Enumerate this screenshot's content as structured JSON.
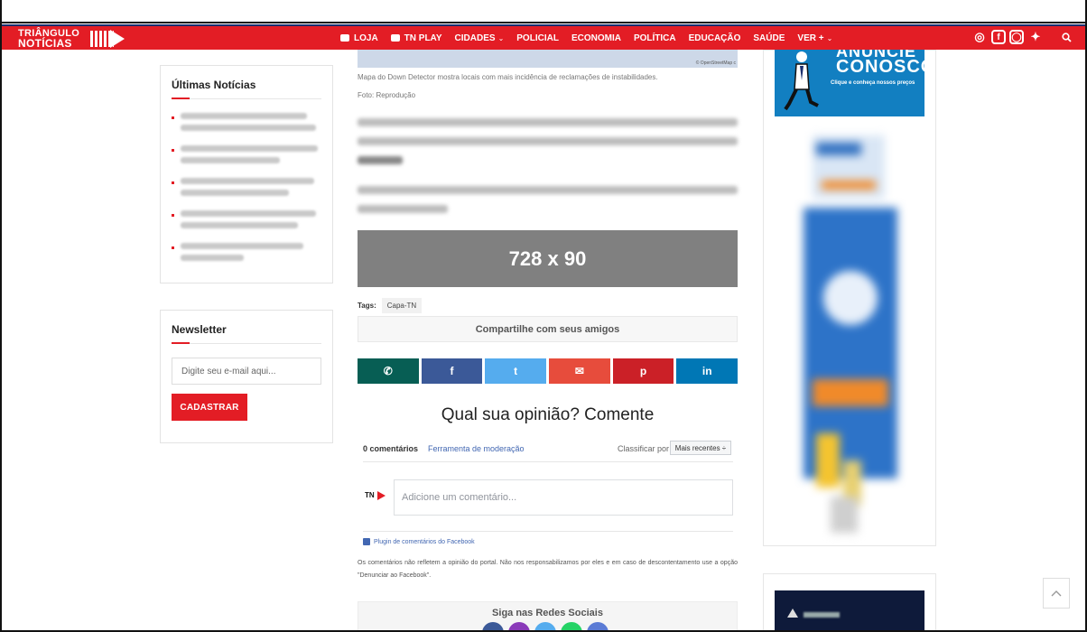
{
  "header": {
    "logo_line1": "TRIÂNGULO",
    "logo_line2": "NOTÍCIAS",
    "menu": [
      {
        "label": "LOJA",
        "icon": "store-icon",
        "chevron": false
      },
      {
        "label": "TN PLAY",
        "icon": "video-camera-icon",
        "chevron": false
      },
      {
        "label": "CIDADES",
        "icon": "",
        "chevron": true
      },
      {
        "label": "POLICIAL",
        "icon": "",
        "chevron": false
      },
      {
        "label": "ECONOMIA",
        "icon": "",
        "chevron": false
      },
      {
        "label": "POLÍTICA",
        "icon": "",
        "chevron": false
      },
      {
        "label": "EDUCAÇÃO",
        "icon": "",
        "chevron": false
      },
      {
        "label": "SAÚDE",
        "icon": "",
        "chevron": false
      },
      {
        "label": "VER +",
        "icon": "",
        "chevron": true
      }
    ],
    "social_icons": [
      "whatsapp-icon",
      "facebook-icon",
      "instagram-icon",
      "twitter-icon"
    ],
    "search_icon": "search-icon",
    "brand_red": "#e31d25"
  },
  "left_sidebar": {
    "latest_title": "Últimas Notícias",
    "newsletter_title": "Newsletter",
    "newsletter_placeholder": "Digite seu e-mail aqui...",
    "newsletter_button": "CADASTRAR"
  },
  "article": {
    "map_credit": "© OpenStreetMap c",
    "caption": "Mapa do Down Detector mostra locais com mais incidência de reclamações de instabilidades.",
    "photo_credit": "Foto: Reprodução",
    "ad_label": "728 x 90",
    "tags_label": "Tags:",
    "tags": [
      "Capa-TN"
    ],
    "share_title": "Compartilhe com seus amigos",
    "share_buttons": [
      {
        "icon": "whatsapp-icon",
        "glyph": "✆",
        "color": "#075e54"
      },
      {
        "icon": "facebook-icon",
        "glyph": "f",
        "color": "#3b5998"
      },
      {
        "icon": "twitter-icon",
        "glyph": "t",
        "color": "#55acee"
      },
      {
        "icon": "email-icon",
        "glyph": "✉",
        "color": "#e74c3c"
      },
      {
        "icon": "pinterest-icon",
        "glyph": "p",
        "color": "#cb2027"
      },
      {
        "icon": "linkedin-icon",
        "glyph": "in",
        "color": "#0077b5"
      }
    ]
  },
  "comments": {
    "heading": "Qual sua opinião? Comente",
    "count_label": "0 comentários",
    "moderation_link": "Ferramenta de moderação",
    "sort_label": "Classificar por",
    "sort_value": "Mais recentes ÷",
    "avatar_text": "TN",
    "comment_placeholder": "Adicione um comentário...",
    "plugin_label": "Plugin de comentários do Facebook",
    "disclaimer": "Os comentários não refletem a opinião do portal. Não nos responsabilizamos por eles e em caso de descontentamento use a opção \"Denunciar ao Facebook\"."
  },
  "follow": {
    "title": "Siga nas Redes Sociais",
    "circle_colors": [
      "#3b5998",
      "#8a3ab9",
      "#55acee",
      "#25d366",
      "#5b7bd5"
    ]
  },
  "right_ad": {
    "line1": "ANUNCIE",
    "line2": "CONOSCO",
    "line3": "Clique e conheça nossos preços"
  }
}
